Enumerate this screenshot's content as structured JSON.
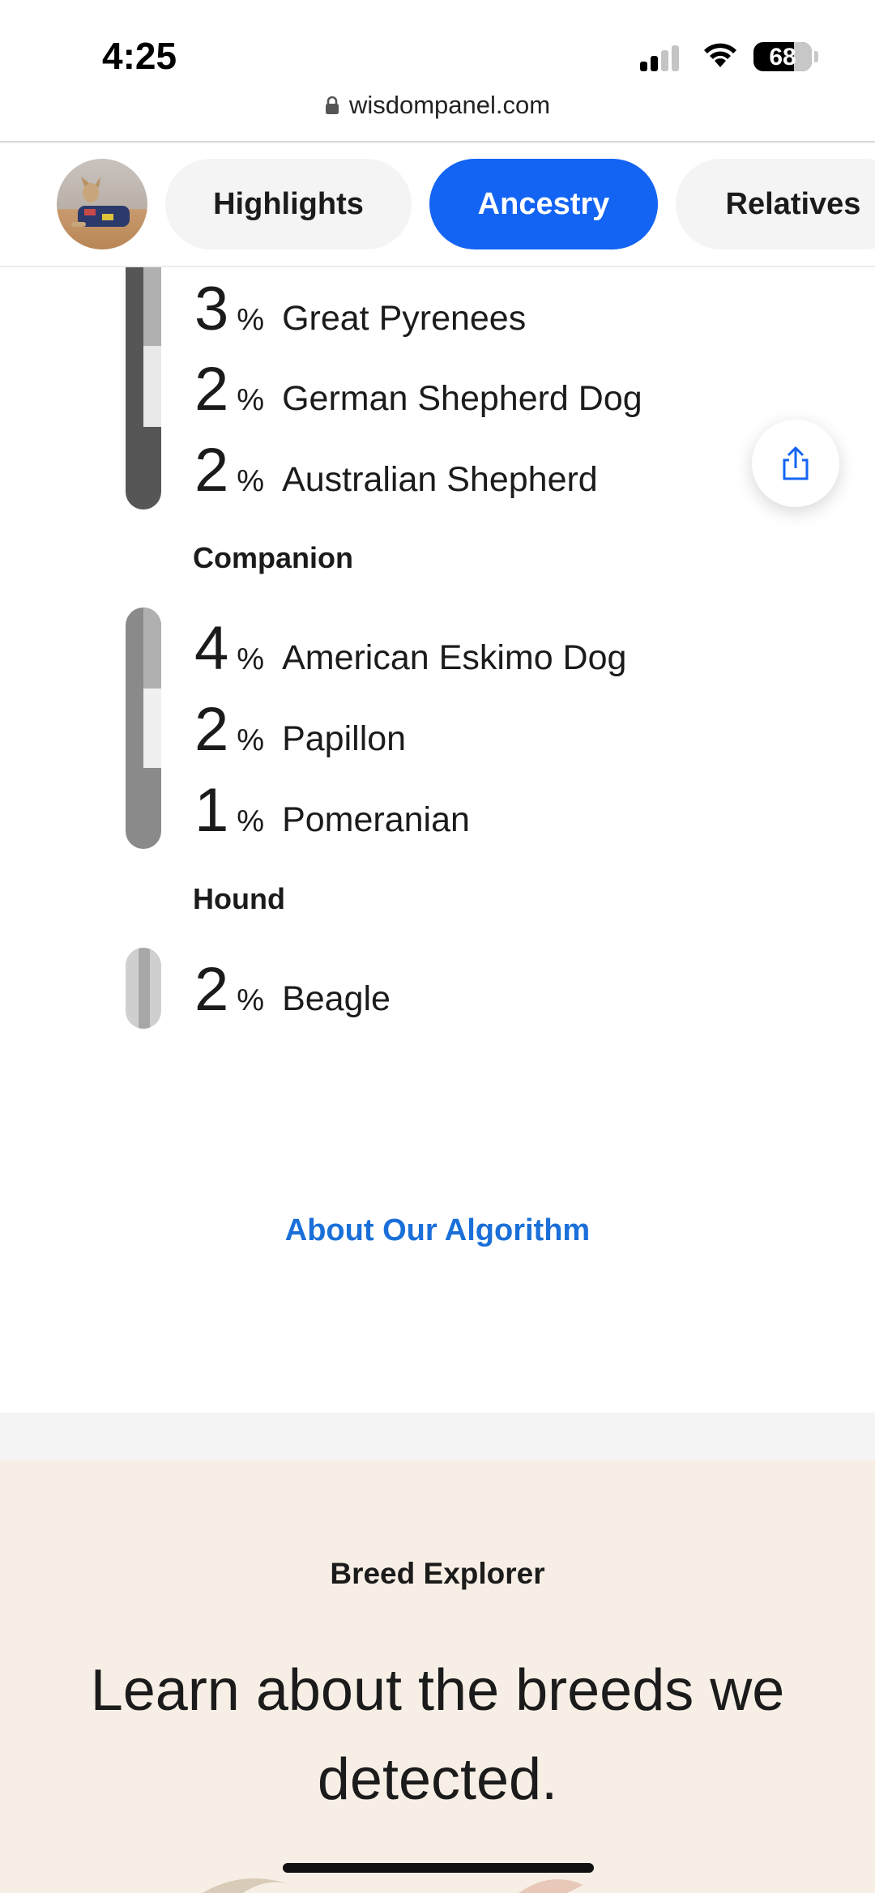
{
  "status_bar": {
    "time": "4:25",
    "battery": "68"
  },
  "browser": {
    "url": "wisdompanel.com"
  },
  "tabs": [
    {
      "label": "Highlights",
      "active": false
    },
    {
      "label": "Ancestry",
      "active": true
    },
    {
      "label": "Relatives",
      "active": false
    }
  ],
  "herding": {
    "breeds": [
      {
        "pct": "3",
        "name": "Great Pyrenees"
      },
      {
        "pct": "2",
        "name": "German Shepherd Dog"
      },
      {
        "pct": "2",
        "name": "Australian Shepherd"
      }
    ]
  },
  "companion": {
    "label": "Companion",
    "breeds": [
      {
        "pct": "4",
        "name": "American Eskimo Dog"
      },
      {
        "pct": "2",
        "name": "Papillon"
      },
      {
        "pct": "1",
        "name": "Pomeranian"
      }
    ]
  },
  "hound": {
    "label": "Hound",
    "breeds": [
      {
        "pct": "2",
        "name": "Beagle"
      }
    ]
  },
  "percent_sign": "%",
  "about_link": "About Our Algorithm",
  "breed_explorer": {
    "label": "Breed Explorer",
    "heading": "Learn about the breeds we detected."
  },
  "icons": [
    "lock-icon",
    "share-icon",
    "signal-icon",
    "wifi-icon",
    "battery-icon"
  ],
  "colors": {
    "accent": "#1464f4",
    "link": "#1a6fd8",
    "explorer_bg": "#f7efe5"
  }
}
